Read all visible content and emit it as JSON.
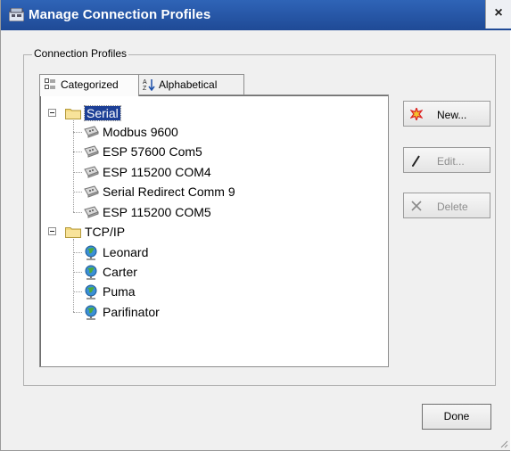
{
  "window": {
    "title": "Manage Connection Profiles",
    "close_label": "×"
  },
  "group": {
    "title": "Connection Profiles"
  },
  "tabs": [
    {
      "label": "Categorized",
      "icon": "categorized-icon",
      "active": true
    },
    {
      "label": "Alphabetical",
      "icon": "sort-az-icon",
      "active": false
    }
  ],
  "tree": {
    "categories": [
      {
        "label": "Serial",
        "selected": true,
        "items": [
          "Modbus 9600",
          "ESP 57600 Com5",
          "ESP 115200 COM4",
          "Serial Redirect Comm 9",
          "ESP 115200 COM5"
        ]
      },
      {
        "label": "TCP/IP",
        "selected": false,
        "items": [
          "Leonard",
          "Carter",
          "Puma",
          "Parifinator"
        ]
      }
    ]
  },
  "buttons": {
    "new_label": "New...",
    "edit_label": "Edit...",
    "delete_label": "Delete",
    "done_label": "Done"
  },
  "colors": {
    "title_bar": "#2f64b7",
    "selection": "#1c3f96",
    "window_bg": "#f0f0f0"
  }
}
